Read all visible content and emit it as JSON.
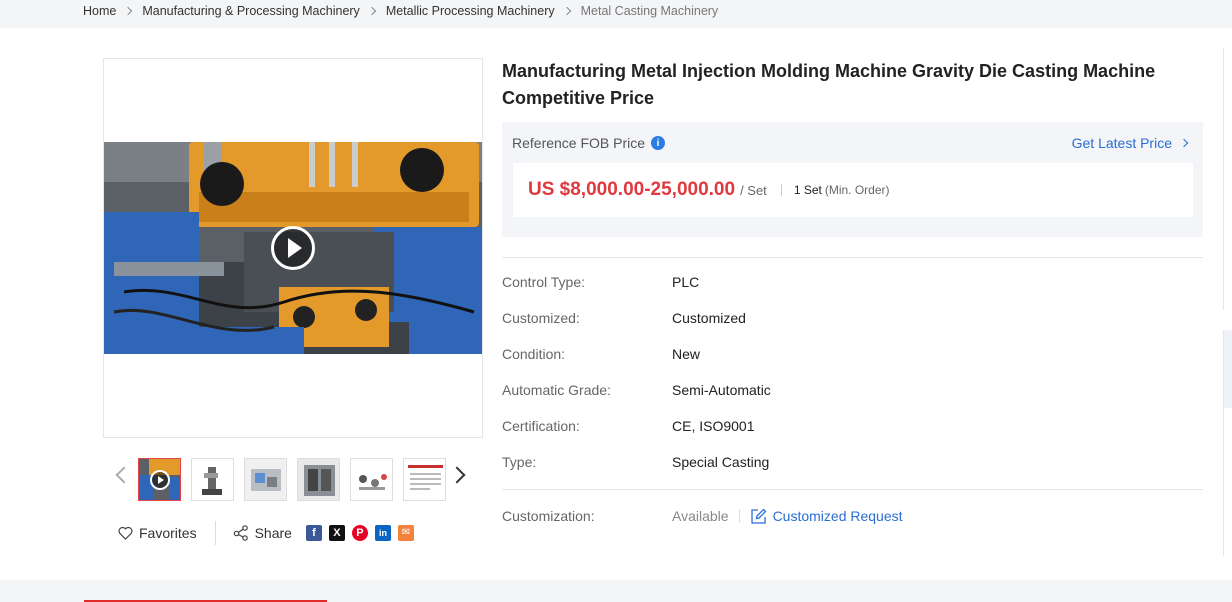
{
  "breadcrumb": {
    "items": [
      "Home",
      "Manufacturing & Processing Machinery",
      "Metallic Processing Machinery",
      "Metal Casting Machinery"
    ]
  },
  "product": {
    "title": "Manufacturing Metal Injection Molding Machine Gravity Die Casting Machine Competitive Price"
  },
  "price": {
    "reference_label": "Reference FOB Price",
    "info_icon": "i",
    "get_latest_label": "Get Latest Price",
    "amount": "US $8,000.00-25,000.00",
    "unit": "/ Set",
    "min_order": "1 Set",
    "min_order_note": "(Min. Order)"
  },
  "specs": [
    {
      "key": "Control Type:",
      "value": "PLC"
    },
    {
      "key": "Customized:",
      "value": "Customized"
    },
    {
      "key": "Condition:",
      "value": "New"
    },
    {
      "key": "Automatic Grade:",
      "value": "Semi-Automatic"
    },
    {
      "key": "Certification:",
      "value": "CE, ISO9001"
    },
    {
      "key": "Type:",
      "value": "Special Casting"
    }
  ],
  "customization": {
    "label": "Customization:",
    "status": "Available",
    "request_label": "Customized Request"
  },
  "actions": {
    "favorites_label": "Favorites",
    "share_label": "Share"
  },
  "social": {
    "facebook": "f",
    "x": "X",
    "pinterest": "P",
    "linkedin": "in",
    "email": "✉"
  },
  "colors": {
    "price_red": "#e0393e",
    "link_blue": "#2a6dd6",
    "facebook": "#3b5998",
    "x": "#111111",
    "pinterest": "#e60023",
    "linkedin": "#0a66c2",
    "email": "#f5823b"
  }
}
